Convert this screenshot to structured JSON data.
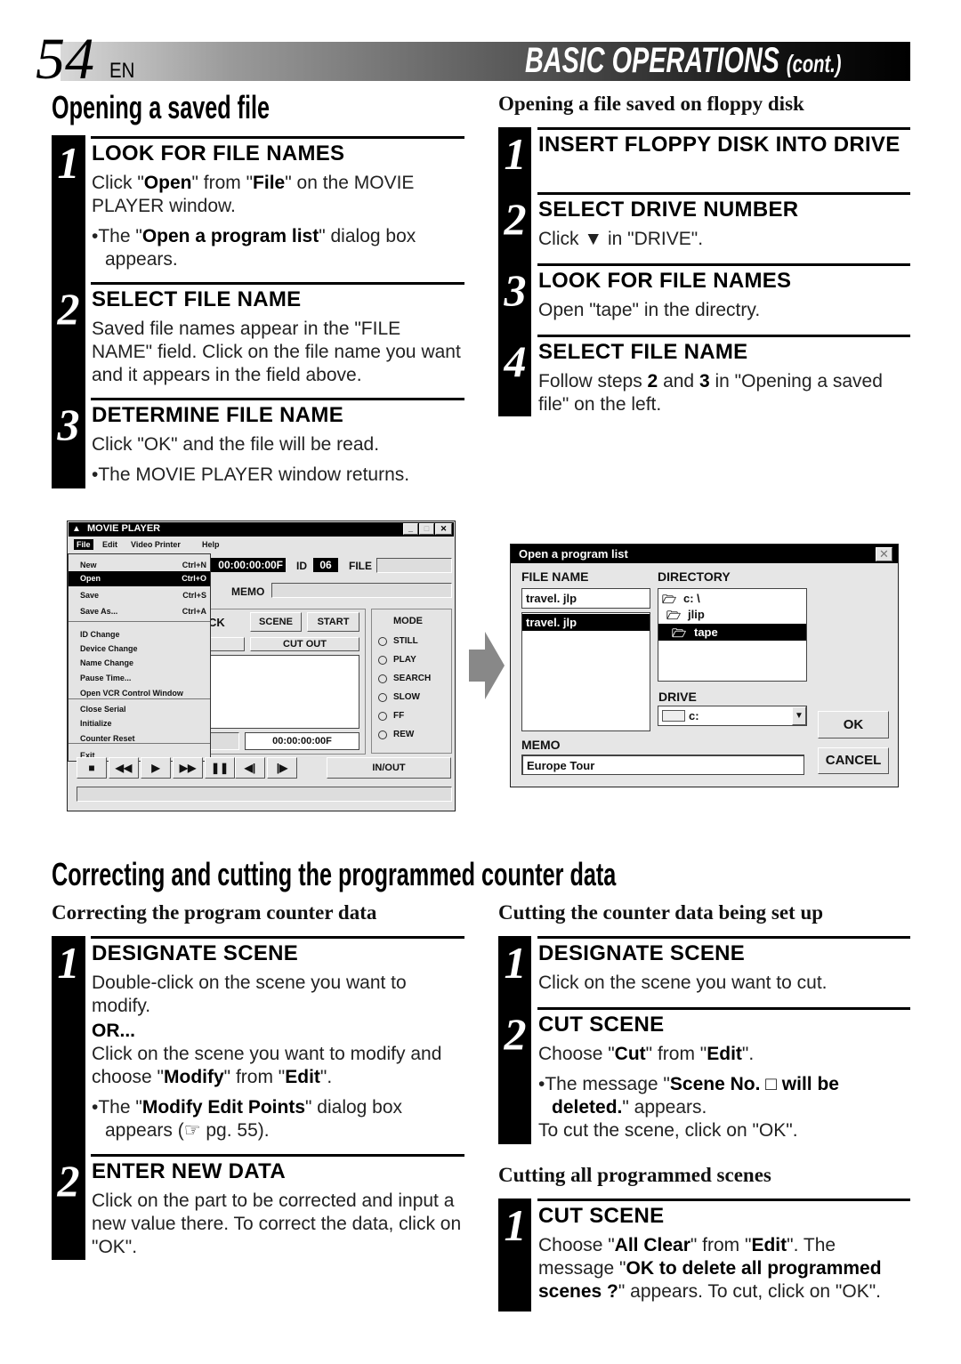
{
  "header": {
    "page_number": "54",
    "lang": "EN",
    "section": "BASIC OPERATIONS",
    "section_suffix": "(cont.)"
  },
  "opening": {
    "title": "Opening a saved file",
    "steps": [
      {
        "num": "1",
        "heading": "LOOK FOR FILE NAMES",
        "body": [
          {
            "type": "p",
            "segs": [
              {
                "t": "Click \""
              },
              {
                "t": "Open",
                "b": true
              },
              {
                "t": "\" from \""
              },
              {
                "t": "File",
                "b": true
              },
              {
                "t": "\" on the MOVIE PLAYER window."
              }
            ]
          },
          {
            "type": "bul",
            "segs": [
              {
                "t": "The \""
              },
              {
                "t": "Open a program list",
                "b": true
              },
              {
                "t": "\" dialog box appears."
              }
            ]
          }
        ]
      },
      {
        "num": "2",
        "heading": "SELECT FILE NAME",
        "body": [
          {
            "type": "p",
            "segs": [
              {
                "t": "Saved file names appear in the \"FILE NAME\" field. Click on the file name you want and it appears in the field above."
              }
            ]
          }
        ]
      },
      {
        "num": "3",
        "heading": "DETERMINE FILE NAME",
        "body": [
          {
            "type": "p",
            "segs": [
              {
                "t": "Click \"OK\" and the file will be read."
              }
            ]
          },
          {
            "type": "bul",
            "segs": [
              {
                "t": "The MOVIE PLAYER window returns."
              }
            ]
          }
        ]
      }
    ]
  },
  "floppy": {
    "subtitle": "Opening a file saved on floppy disk",
    "steps": [
      {
        "num": "1",
        "heading": "INSERT FLOPPY DISK INTO DRIVE",
        "body": []
      },
      {
        "num": "2",
        "heading": "SELECT DRIVE NUMBER",
        "body": [
          {
            "type": "p",
            "segs": [
              {
                "t": "Click ▼ in \"DRIVE\"."
              }
            ]
          }
        ]
      },
      {
        "num": "3",
        "heading": "LOOK FOR FILE NAMES",
        "body": [
          {
            "type": "p",
            "segs": [
              {
                "t": "Open \"tape\" in the directry."
              }
            ]
          }
        ]
      },
      {
        "num": "4",
        "heading": "SELECT FILE NAME",
        "body": [
          {
            "type": "p",
            "segs": [
              {
                "t": "Follow steps "
              },
              {
                "t": "2",
                "b": true
              },
              {
                "t": " and "
              },
              {
                "t": "3",
                "b": true
              },
              {
                "t": " in \"Opening a saved file\" on the left."
              }
            ]
          }
        ]
      }
    ]
  },
  "movie_player": {
    "title": "MOVIE PLAYER",
    "menus": [
      "File",
      "Edit",
      "Video Printer",
      "Help"
    ],
    "file_menu": [
      {
        "label": "New",
        "shortcut": "Ctrl+N"
      },
      {
        "label": "Open",
        "shortcut": "Ctrl+O",
        "selected": true
      },
      {
        "label": "Save",
        "shortcut": "Ctrl+S"
      },
      {
        "label": "Save As...",
        "shortcut": "Ctrl+A"
      },
      {
        "label": "ID Change"
      },
      {
        "label": "Device Change"
      },
      {
        "label": "Name Change"
      },
      {
        "label": "Pause Time..."
      },
      {
        "label": "Open VCR Control Window"
      },
      {
        "label": "Close Serial"
      },
      {
        "label": "Initialize"
      },
      {
        "label": "Counter Reset"
      },
      {
        "label": "Exit"
      }
    ],
    "counter": "00:00:00:00F",
    "id_label": "ID",
    "id_value": "06",
    "file_label": "FILE",
    "memo_label": "MEMO",
    "partial_label": "CK",
    "scene_button": "SCENE",
    "start_button": "START",
    "cut_out_button": "CUT OUT",
    "end_counter": "00:00:00:00F",
    "mode_label": "MODE",
    "modes": [
      "STILL",
      "PLAY",
      "SEARCH",
      "SLOW",
      "FF",
      "REW"
    ],
    "transport": [
      "■",
      "◀◀",
      "▶",
      "▶▶",
      "❚❚",
      "◀|",
      "|▶"
    ],
    "in_out_button": "IN/OUT"
  },
  "dialog": {
    "title": "Open a program list",
    "file_name_label": "FILE NAME",
    "file_name_value": "travel. jlp",
    "files": [
      "travel. jlp"
    ],
    "directory_label": "DIRECTORY",
    "directories": [
      "c: \\",
      "jlip",
      "tape"
    ],
    "drive_label": "DRIVE",
    "drive_value": "c:",
    "memo_label": "MEMO",
    "memo_value": "Europe Tour",
    "ok": "OK",
    "cancel": "CANCEL"
  },
  "correcting": {
    "title": "Correcting and cutting the programmed counter data",
    "left_subtitle": "Correcting the program counter data",
    "left_steps": [
      {
        "num": "1",
        "heading": "DESIGNATE SCENE",
        "body": [
          {
            "type": "p",
            "segs": [
              {
                "t": "Double-click on the scene you want to modify."
              }
            ]
          },
          {
            "type": "or",
            "segs": [
              {
                "t": "OR..."
              }
            ]
          },
          {
            "type": "p",
            "segs": [
              {
                "t": "Click on the scene you want to modify and choose \""
              },
              {
                "t": "Modify",
                "b": true
              },
              {
                "t": "\" from \""
              },
              {
                "t": "Edit",
                "b": true
              },
              {
                "t": "\"."
              }
            ]
          },
          {
            "type": "bul",
            "segs": [
              {
                "t": "The \""
              },
              {
                "t": "Modify Edit Points",
                "b": true
              },
              {
                "t": "\" dialog box appears (☞ pg. 55)."
              }
            ]
          }
        ]
      },
      {
        "num": "2",
        "heading": "ENTER NEW DATA",
        "body": [
          {
            "type": "p",
            "segs": [
              {
                "t": "Click on the part to be corrected and input a new value there. To correct the data, click on \"OK\"."
              }
            ]
          }
        ]
      }
    ],
    "right_subtitle": "Cutting the counter data being set up",
    "right_steps": [
      {
        "num": "1",
        "heading": "DESIGNATE SCENE",
        "body": [
          {
            "type": "p",
            "segs": [
              {
                "t": "Click on the scene you want to cut."
              }
            ]
          }
        ]
      },
      {
        "num": "2",
        "heading": "CUT SCENE",
        "body": [
          {
            "type": "p",
            "segs": [
              {
                "t": "Choose \""
              },
              {
                "t": "Cut",
                "b": true
              },
              {
                "t": "\" from \""
              },
              {
                "t": "Edit",
                "b": true
              },
              {
                "t": "\"."
              }
            ]
          },
          {
            "type": "bul",
            "segs": [
              {
                "t": "The message \""
              },
              {
                "t": "Scene No. □ will be deleted.",
                "b": true
              },
              {
                "t": "\" appears."
              }
            ]
          },
          {
            "type": "p",
            "segs": [
              {
                "t": "To cut the scene, click on \"OK\"."
              }
            ]
          }
        ]
      }
    ],
    "all_subtitle": "Cutting all programmed scenes",
    "all_steps": [
      {
        "num": "1",
        "heading": "CUT SCENE",
        "body": [
          {
            "type": "p",
            "segs": [
              {
                "t": "Choose \""
              },
              {
                "t": "All Clear",
                "b": true
              },
              {
                "t": "\" from \""
              },
              {
                "t": "Edit",
                "b": true
              },
              {
                "t": "\". The message \""
              },
              {
                "t": "OK to delete all programmed scenes ?",
                "b": true
              },
              {
                "t": "\" appears. To cut, click on \"OK\"."
              }
            ]
          }
        ]
      }
    ]
  }
}
